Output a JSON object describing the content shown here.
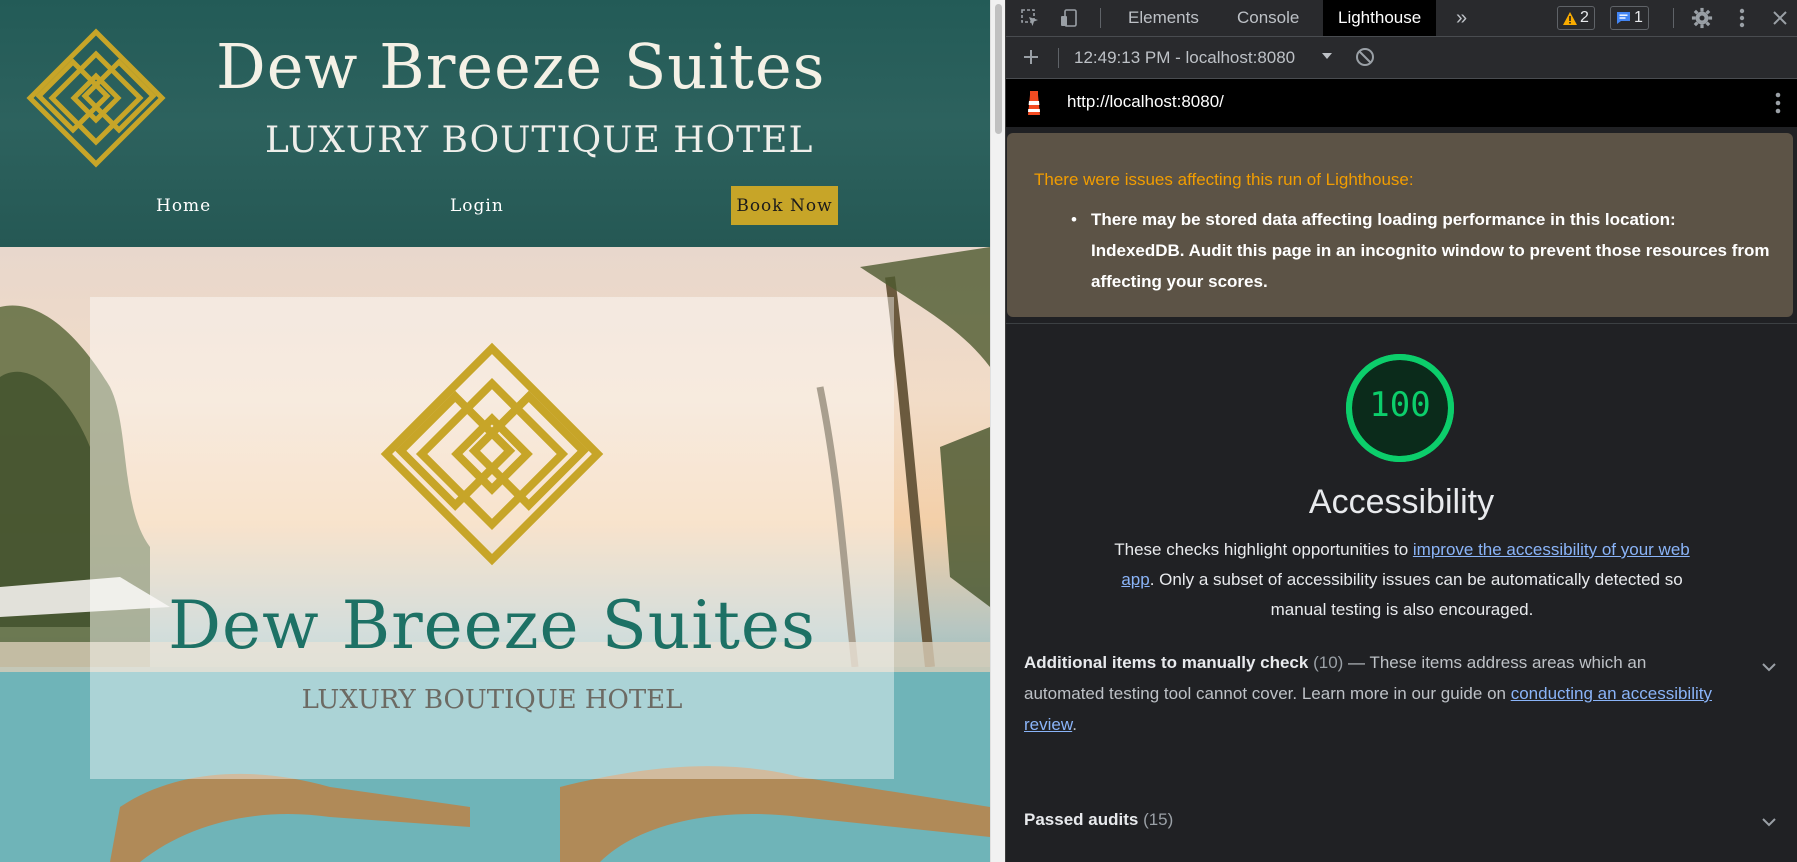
{
  "site": {
    "header_title": "Dew Breeze Suites",
    "header_subtitle": "LUXURY BOUTIQUE HOTEL",
    "nav": {
      "home": "Home",
      "login": "Login",
      "book_now": "Book Now"
    },
    "hero_title": "Dew Breeze Suites",
    "hero_subtitle": "LUXURY BOUTIQUE HOTEL",
    "colors": {
      "header_bg": "#2b5f5b",
      "gold": "#c7a528",
      "hero_title": "#1d7165"
    }
  },
  "devtools": {
    "tabs": [
      "Elements",
      "Console",
      "Lighthouse"
    ],
    "active_tab": "Lighthouse",
    "more_tabs_icon": "»",
    "warnings_count": "2",
    "messages_count": "1",
    "report_time": "12:49:13 PM - localhost:8080",
    "url": "http://localhost:8080/",
    "warning_title": "There were issues affecting this run of Lighthouse:",
    "warning_item": "There may be stored data affecting loading performance in this location: IndexedDB. Audit this page in an incognito window to prevent those resources from affecting your scores.",
    "score": "100",
    "score_fraction": 1.0,
    "category_title": "Accessibility",
    "desc_before": "These checks highlight opportunities to ",
    "desc_link": "improve the accessibility of your web app",
    "desc_after": ". Only a subset of accessibility issues can be automatically detected so manual testing is also encouraged.",
    "manual_title": "Additional items to manually check",
    "manual_count": "(10)",
    "manual_dash": " — ",
    "manual_desc": "These items address areas which an automated testing tool cannot cover. Learn more in our guide on ",
    "manual_link": "conducting an accessibility review",
    "manual_end": ".",
    "passed_title": "Passed audits",
    "passed_count": "(15)",
    "colors": {
      "score_green": "#0cce6b",
      "link": "#8ab4f8",
      "warning": "#f29d00"
    }
  }
}
